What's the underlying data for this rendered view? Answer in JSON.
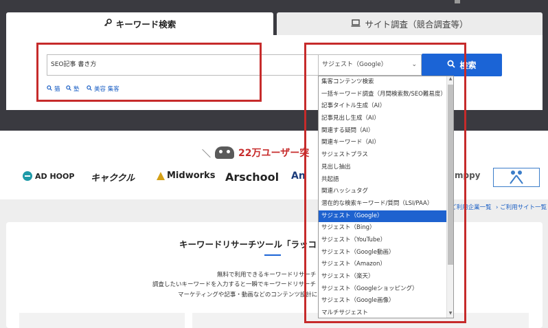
{
  "tabs": {
    "keyword": {
      "label": "キーワード検索",
      "icon": "key-icon"
    },
    "site": {
      "label": "サイト調査（競合調査等）",
      "icon": "laptop-icon"
    }
  },
  "search": {
    "value": "SEO記事 書き方",
    "select_value": "サジェスト（Google）",
    "button_label": "検索"
  },
  "history": [
    {
      "label": "猫"
    },
    {
      "label": "塾"
    },
    {
      "label": "美容 集客"
    }
  ],
  "dropdown": {
    "options": [
      "集客コンテンツ検索",
      "一括キーワード調査（月間検索数/SEO難易度）",
      "記事タイトル生成（AI）",
      "記事見出し生成（AI）",
      "関連する疑問（AI）",
      "関連キーワード（AI）",
      "サジェストプラス",
      "見出し抽出",
      "共起語",
      "関連ハッシュタグ",
      "潜在的な検索キーワード/質問（LSI/PAA）",
      "サジェスト（Google）",
      "サジェスト（Bing）",
      "サジェスト（YouTube）",
      "サジェスト（Google動画）",
      "サジェスト（Amazon）",
      "サジェスト（楽天）",
      "サジェスト（Googleショッピング）",
      "サジェスト（Google画像）",
      "マルチサジェスト"
    ],
    "selected_index": 11
  },
  "banner": {
    "users_prefix": "＼",
    "users_count": "22万ユーザー突",
    "logos": [
      "AD HOOP",
      "キャククル",
      "Midworks",
      "Arschool",
      "An",
      "mppy"
    ]
  },
  "links": {
    "companies": "ご利用企業一覧",
    "sites": "ご利用サイト一覧"
  },
  "card": {
    "title": "キーワードリサーチツール「ラッコ",
    "line1": "無料で利用できるキーワードリサーチ",
    "line2": "調査したいキーワードを入力すると一瞬でキーワードリサーチ",
    "line3": "マーケティングや記事・動画などのコンテンツ設計に"
  },
  "colors": {
    "accent": "#1b64d6",
    "highlight_box": "#c62b2b",
    "header_bg": "#3a3a40",
    "users_count": "#c72c2c"
  }
}
